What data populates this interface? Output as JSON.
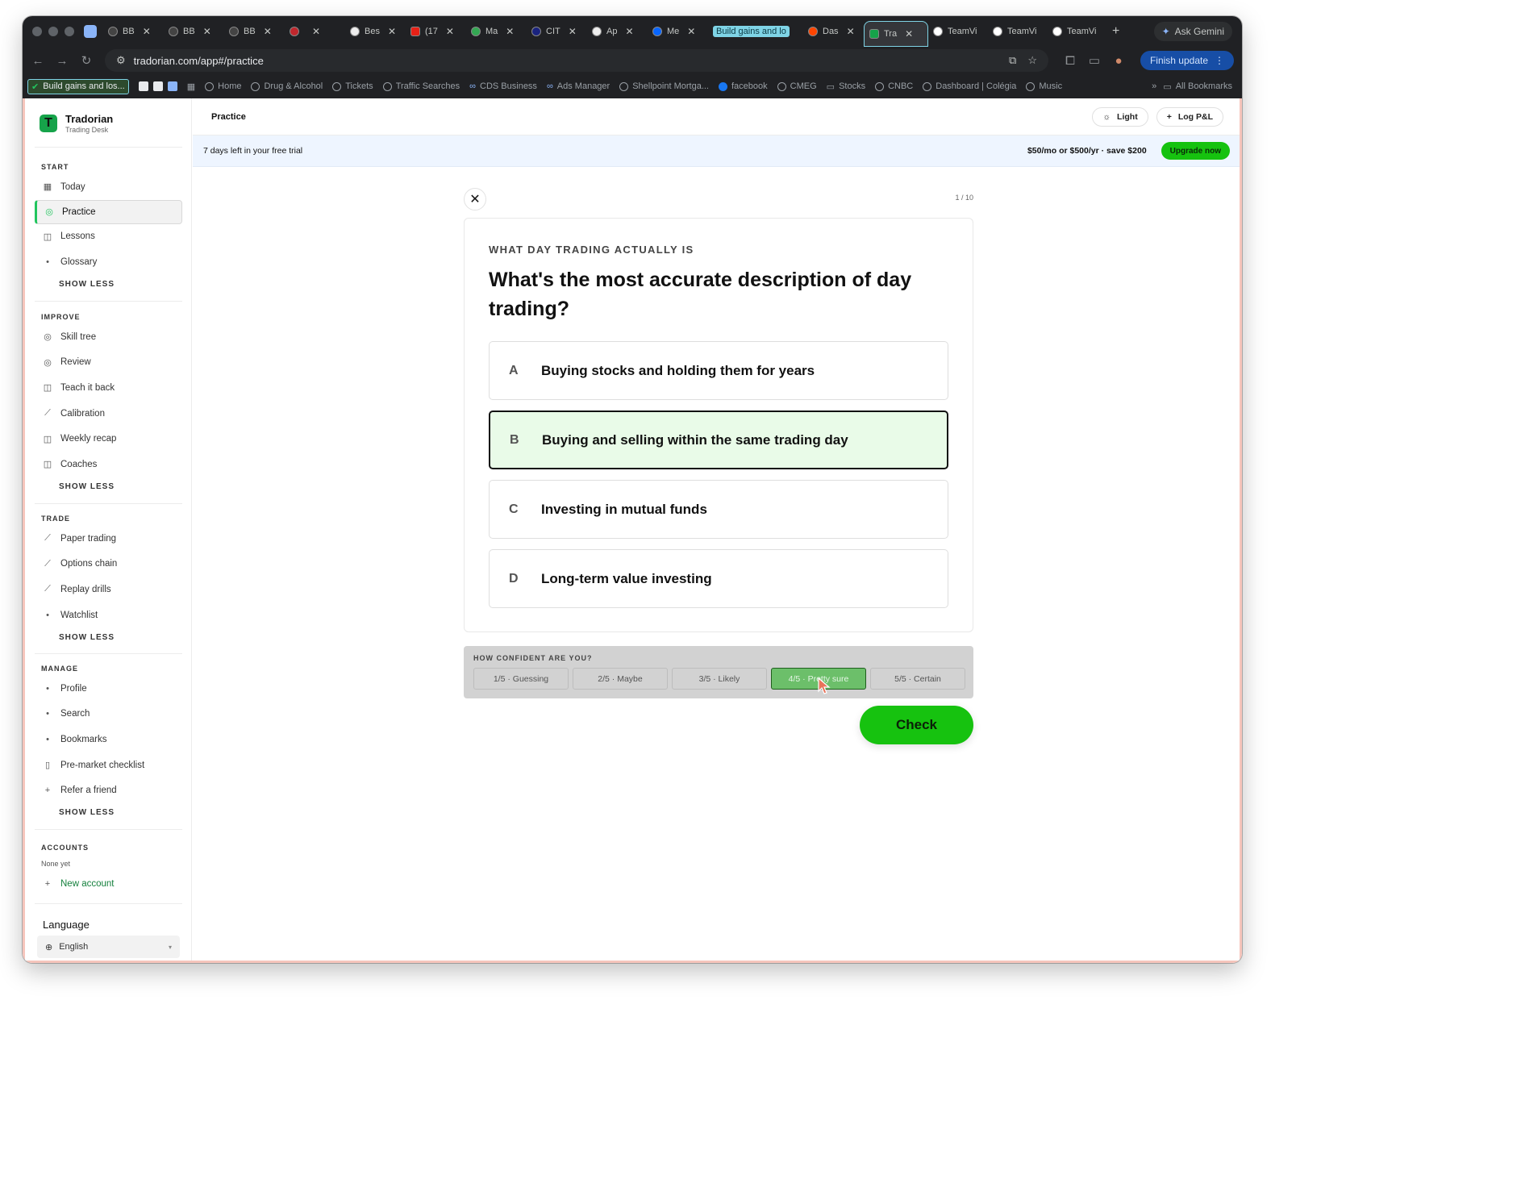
{
  "browser": {
    "tabs": [
      {
        "label": "BB",
        "icon": "tradorian-icon"
      },
      {
        "label": "BB",
        "icon": "tradorian-icon"
      },
      {
        "label": "BB",
        "icon": "tradorian-icon"
      },
      {
        "label": "",
        "icon": "recording-icon"
      },
      {
        "label": "Bes",
        "icon": "openai-icon"
      },
      {
        "label": "(17",
        "icon": "youtube-icon"
      },
      {
        "label": "Ma",
        "icon": "maps-icon"
      },
      {
        "label": "CIT",
        "icon": "cit-icon"
      },
      {
        "label": "Ap",
        "icon": "openai-icon"
      },
      {
        "label": "Me",
        "icon": "meta-icon"
      },
      {
        "label": "Build gains and lo",
        "icon": "check-icon"
      },
      {
        "label": "Das",
        "icon": "reddit-icon"
      },
      {
        "label": "Tra",
        "icon": "tradorian-icon"
      },
      {
        "label": "TeamVi",
        "icon": "teamviewer-icon"
      },
      {
        "label": "TeamVi",
        "icon": "teamviewer-icon"
      },
      {
        "label": "TeamVi",
        "icon": "teamviewer-icon"
      }
    ],
    "ask_gemini": "Ask Gemini",
    "url": "tradorian.com/app#/practice",
    "finish_update": "Finish update",
    "bookmarks": {
      "first": "Build gains and los...",
      "items": [
        "Home",
        "Drug & Alcohol",
        "Tickets",
        "Traffic Searches",
        "CDS Business",
        "Ads Manager",
        "Shellpoint Mortga...",
        "facebook",
        "CMEG",
        "Stocks",
        "CNBC",
        "Dashboard | Colégia",
        "Music"
      ],
      "all": "All Bookmarks"
    }
  },
  "sidebar": {
    "brand": "Tradorian",
    "brand_sub": "Trading Desk",
    "sections": {
      "start": {
        "title": "START",
        "items": [
          {
            "label": "Today",
            "icon": "grid-icon"
          },
          {
            "label": "Practice",
            "icon": "target-icon"
          },
          {
            "label": "Lessons",
            "icon": "book-icon"
          },
          {
            "label": "Glossary",
            "icon": "dot-icon"
          }
        ],
        "show_less": "SHOW LESS"
      },
      "improve": {
        "title": "IMPROVE",
        "items": [
          {
            "label": "Skill tree",
            "icon": "target-icon"
          },
          {
            "label": "Review",
            "icon": "target-icon"
          },
          {
            "label": "Teach it back",
            "icon": "book-icon"
          },
          {
            "label": "Calibration",
            "icon": "chart-icon"
          },
          {
            "label": "Weekly recap",
            "icon": "book-icon"
          },
          {
            "label": "Coaches",
            "icon": "book-icon"
          }
        ],
        "show_less": "SHOW LESS"
      },
      "trade": {
        "title": "TRADE",
        "items": [
          {
            "label": "Paper trading",
            "icon": "chart-icon"
          },
          {
            "label": "Options chain",
            "icon": "chart-icon"
          },
          {
            "label": "Replay drills",
            "icon": "chart-icon"
          },
          {
            "label": "Watchlist",
            "icon": "dot-icon"
          }
        ],
        "show_less": "SHOW LESS"
      },
      "manage": {
        "title": "MANAGE",
        "items": [
          {
            "label": "Profile",
            "icon": "dot-icon"
          },
          {
            "label": "Search",
            "icon": "dot-icon"
          },
          {
            "label": "Bookmarks",
            "icon": "dot-icon"
          },
          {
            "label": "Pre-market checklist",
            "icon": "clipboard-icon"
          },
          {
            "label": "Refer a friend",
            "icon": "plus-icon"
          }
        ],
        "show_less": "SHOW LESS"
      },
      "accounts": {
        "title": "ACCOUNTS",
        "none": "None yet",
        "new": "New account"
      }
    },
    "language": {
      "title": "Language",
      "value": "English"
    }
  },
  "header": {
    "title": "Practice",
    "light": "Light",
    "log_pnl": "Log P&L"
  },
  "trial": {
    "message": "7 days left in your free trial",
    "pricing": "$50/mo or $500/yr · save $200",
    "upgrade": "Upgrade now"
  },
  "quiz": {
    "progress": "1 / 10",
    "eyebrow": "WHAT DAY TRADING ACTUALLY IS",
    "question": "What's the most accurate description of day trading?",
    "options": [
      {
        "letter": "A",
        "text": "Buying stocks and holding them for years"
      },
      {
        "letter": "B",
        "text": "Buying and selling within the same trading day"
      },
      {
        "letter": "C",
        "text": "Investing in mutual funds"
      },
      {
        "letter": "D",
        "text": "Long-term value investing"
      }
    ],
    "selected": "B",
    "confidence": {
      "title": "HOW CONFIDENT ARE YOU?",
      "options": [
        "1/5 · Guessing",
        "2/5 · Maybe",
        "3/5 · Likely",
        "4/5 · Pretty sure",
        "5/5 · Certain"
      ],
      "selected": "4/5 · Pretty sure"
    },
    "check": "Check"
  },
  "colors": {
    "accent_green": "#16c20f",
    "selected_bg": "#e9fbe8",
    "trial_bg": "#eef5ff"
  }
}
